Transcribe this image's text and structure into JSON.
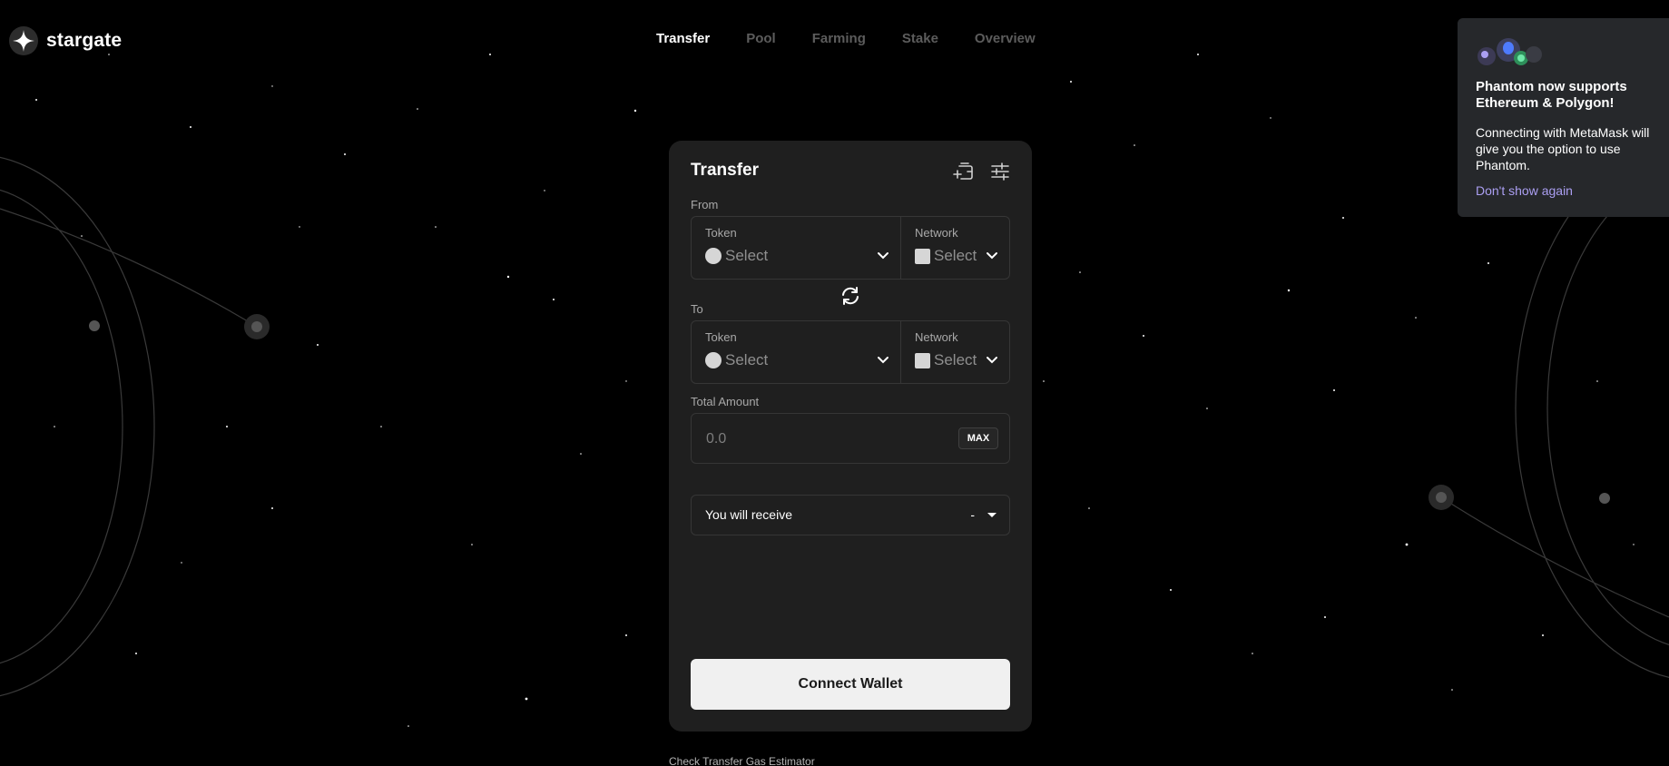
{
  "brand": {
    "name": "stargate"
  },
  "nav": {
    "items": [
      {
        "label": "Transfer",
        "active": true
      },
      {
        "label": "Pool",
        "active": false
      },
      {
        "label": "Farming",
        "active": false
      },
      {
        "label": "Stake",
        "active": false
      },
      {
        "label": "Overview",
        "active": false
      }
    ]
  },
  "transfer": {
    "title": "Transfer",
    "icons": [
      "add-token-icon",
      "settings-sliders-icon"
    ],
    "from": {
      "label": "From",
      "token_label": "Token",
      "token_value": "Select",
      "network_label": "Network",
      "network_value": "Select"
    },
    "to": {
      "label": "To",
      "token_label": "Token",
      "token_value": "Select",
      "network_label": "Network",
      "network_value": "Select"
    },
    "amount": {
      "label": "Total Amount",
      "placeholder": "0.0",
      "max_label": "MAX"
    },
    "receive": {
      "label": "You will receive",
      "value": "-"
    },
    "connect_label": "Connect Wallet",
    "gas_link": "Check Transfer Gas Estimator"
  },
  "toast": {
    "title": "Phantom now supports Ethereum & Polygon!",
    "body": "Connecting with MetaMask will give you the option to use Phantom.",
    "dismiss": "Don't show again"
  },
  "colors": {
    "background": "#000000",
    "card": "#1f1f1f",
    "border": "#363636",
    "button": "#f0f0f0",
    "toast": "#26282b",
    "link_accent": "#ab9ff2"
  }
}
